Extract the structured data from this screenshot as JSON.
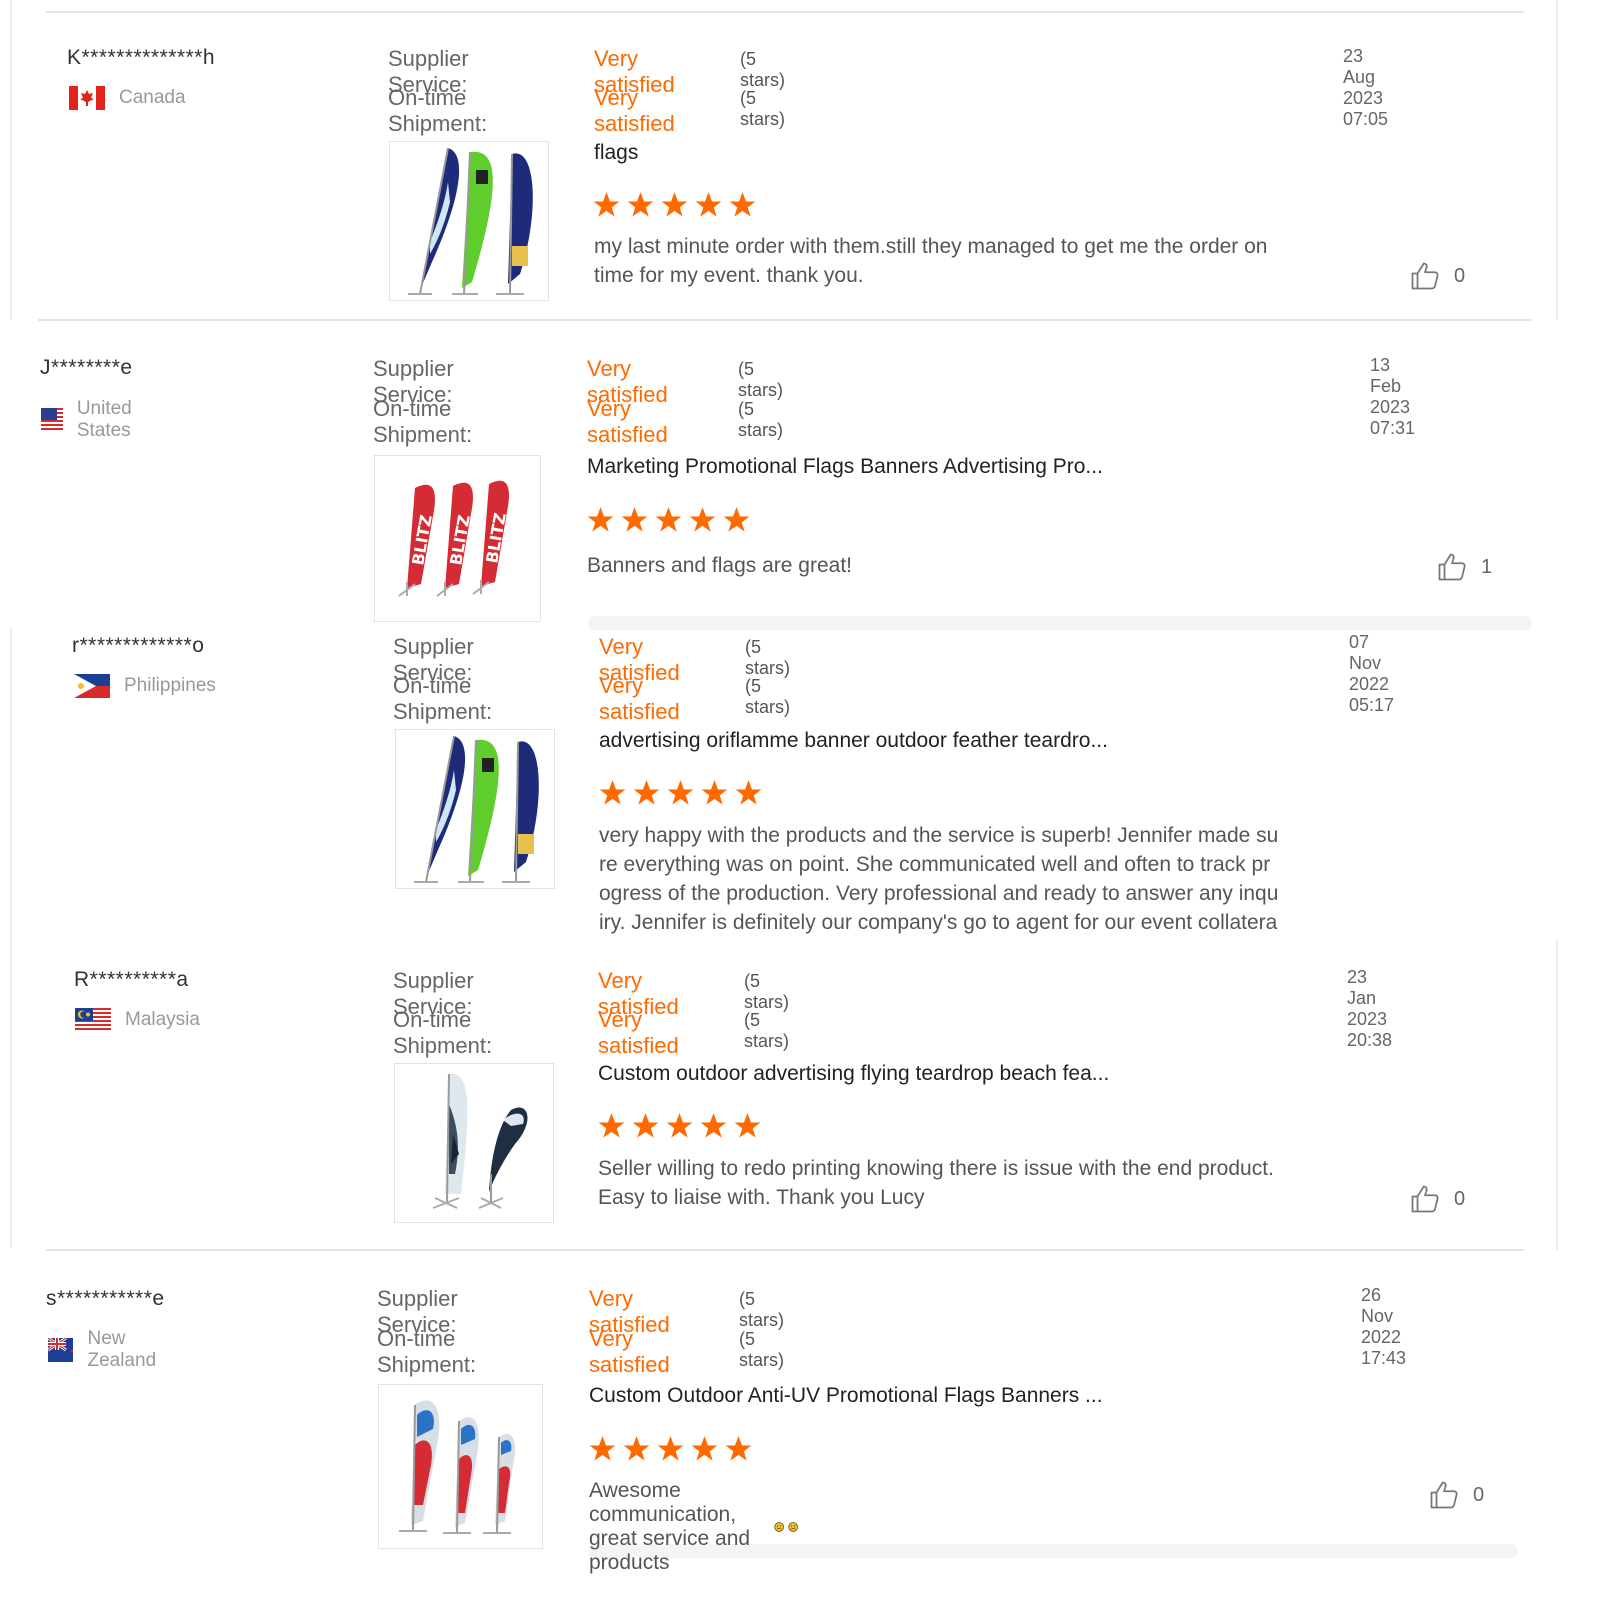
{
  "labels": {
    "supplier_service": "Supplier Service:",
    "ontime_shipment": "On-time Shipment:"
  },
  "accent_color": "#ff6a00",
  "reviews": [
    {
      "user": "K**************h",
      "country": "Canada",
      "flag": "canada-flag-icon",
      "supplier_value": "Very satisfied",
      "supplier_stars": "(5 stars)",
      "shipment_value": "Very satisfied",
      "shipment_stars": "(5 stars)",
      "date": "23 Aug 2023 07:05",
      "product_title": "flags",
      "rating": 5,
      "text": "my last minute order with them.still they managed to get me the order on\ntime for my event. thank you.",
      "likes": "0"
    },
    {
      "user": "J********e",
      "country": "United States",
      "flag": "usa-flag-icon",
      "supplier_value": "Very satisfied",
      "supplier_stars": "(5 stars)",
      "shipment_value": "Very satisfied",
      "shipment_stars": "(5 stars)",
      "date": "13 Feb 2023 07:31",
      "product_title": "Marketing Promotional Flags Banners Advertising Pro...",
      "rating": 5,
      "text": "Banners and flags are great!",
      "likes": "1"
    },
    {
      "user": "r*************o",
      "country": "Philippines",
      "flag": "philippines-flag-icon",
      "supplier_value": "Very satisfied",
      "supplier_stars": "(5 stars)",
      "shipment_value": "Very satisfied",
      "shipment_stars": "(5 stars)",
      "date": "07 Nov 2022 05:17",
      "product_title": "advertising oriflamme banner outdoor feather teardro...",
      "rating": 5,
      "text": "very happy with the products and the service is superb!  Jennifer made su\nre everything was on point.   She communicated well and often to track pr\nogress of the production.  Very professional and ready to answer any inqu\niry.  Jennifer is definitely our company's go to agent for our event collatera"
    },
    {
      "user": "R**********a",
      "country": "Malaysia",
      "flag": "malaysia-flag-icon",
      "supplier_value": "Very satisfied",
      "supplier_stars": "(5 stars)",
      "shipment_value": "Very satisfied",
      "shipment_stars": "(5 stars)",
      "date": "23 Jan 2023 20:38",
      "product_title": "Custom outdoor advertising flying teardrop beach fea...",
      "rating": 5,
      "text": "Seller willing to redo printing knowing there is issue with the end product.\nEasy to liaise with. Thank you Lucy",
      "likes": "0"
    },
    {
      "user": "s***********e",
      "country": "New Zealand",
      "flag": "new-zealand-flag-icon",
      "supplier_value": "Very satisfied",
      "supplier_stars": "(5 stars)",
      "shipment_value": "Very satisfied",
      "shipment_stars": "(5 stars)",
      "date": "26 Nov 2022 17:43",
      "product_title": "Custom Outdoor Anti-UV Promotional Flags Banners ...",
      "rating": 5,
      "text": "Awesome communication, great service and products",
      "likes": "0"
    }
  ]
}
